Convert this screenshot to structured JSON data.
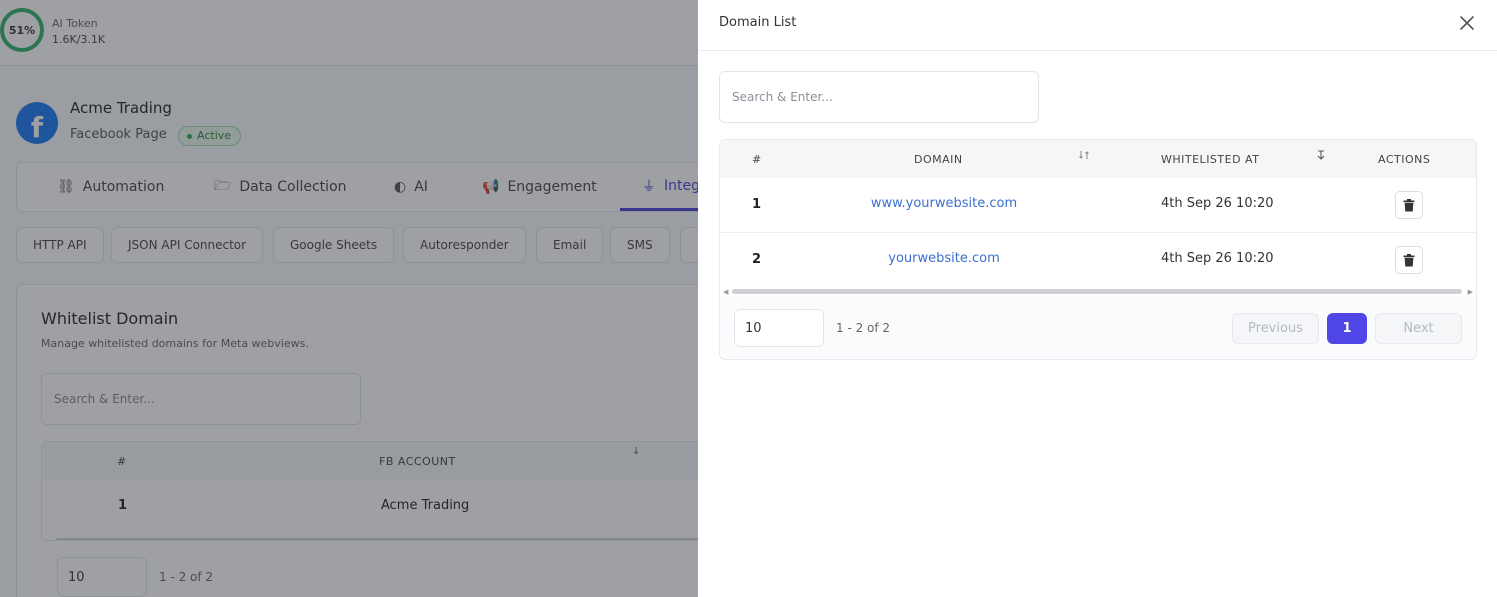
{
  "colors": {
    "accent": "#4f46e5",
    "link": "#3b6fcf",
    "success": "#2fb36b",
    "facebook": "#1877f2"
  },
  "token": {
    "percent_label": "51%",
    "title": "AI Token",
    "usage": "1.6K/3.1K"
  },
  "account": {
    "logo_letter": "f",
    "name": "Acme Trading",
    "type": "Facebook Page",
    "status": "Active"
  },
  "main_tabs": [
    {
      "label": "Automation",
      "icon": "automation-icon"
    },
    {
      "label": "Data Collection",
      "icon": "folder-icon"
    },
    {
      "label": "AI",
      "icon": "ai-icon"
    },
    {
      "label": "Engagement",
      "icon": "megaphone-icon"
    },
    {
      "label": "Integ",
      "icon": "plug-icon",
      "active": true
    }
  ],
  "sub_tabs": [
    "HTTP API",
    "JSON API Connector",
    "Google Sheets",
    "Autoresponder",
    "Email",
    "SMS"
  ],
  "whitelist_card": {
    "title": "Whitelist Domain",
    "subtitle": "Manage whitelisted domains for Meta webviews.",
    "search_placeholder": "Search & Enter...",
    "columns": [
      "#",
      "FB ACCOUNT"
    ],
    "rows": [
      {
        "num": "1",
        "account": "Acme Trading"
      }
    ],
    "page_size": "10",
    "page_info": "1 - 2 of 2"
  },
  "drawer": {
    "title": "Domain List",
    "close_icon": "close-icon",
    "search_placeholder": "Search & Enter...",
    "columns": {
      "num": "#",
      "domain": "DOMAIN",
      "whitelisted_at": "WHITELISTED AT",
      "actions": "ACTIONS"
    },
    "rows": [
      {
        "num": "1",
        "domain": "www.yourwebsite.com",
        "whitelisted_at": "4th Sep 26 10:20"
      },
      {
        "num": "2",
        "domain": "yourwebsite.com",
        "whitelisted_at": "4th Sep 26 10:20"
      }
    ],
    "pagination": {
      "page_size": "10",
      "info": "1 - 2 of 2",
      "previous": "Previous",
      "current_page": "1",
      "next": "Next"
    }
  }
}
